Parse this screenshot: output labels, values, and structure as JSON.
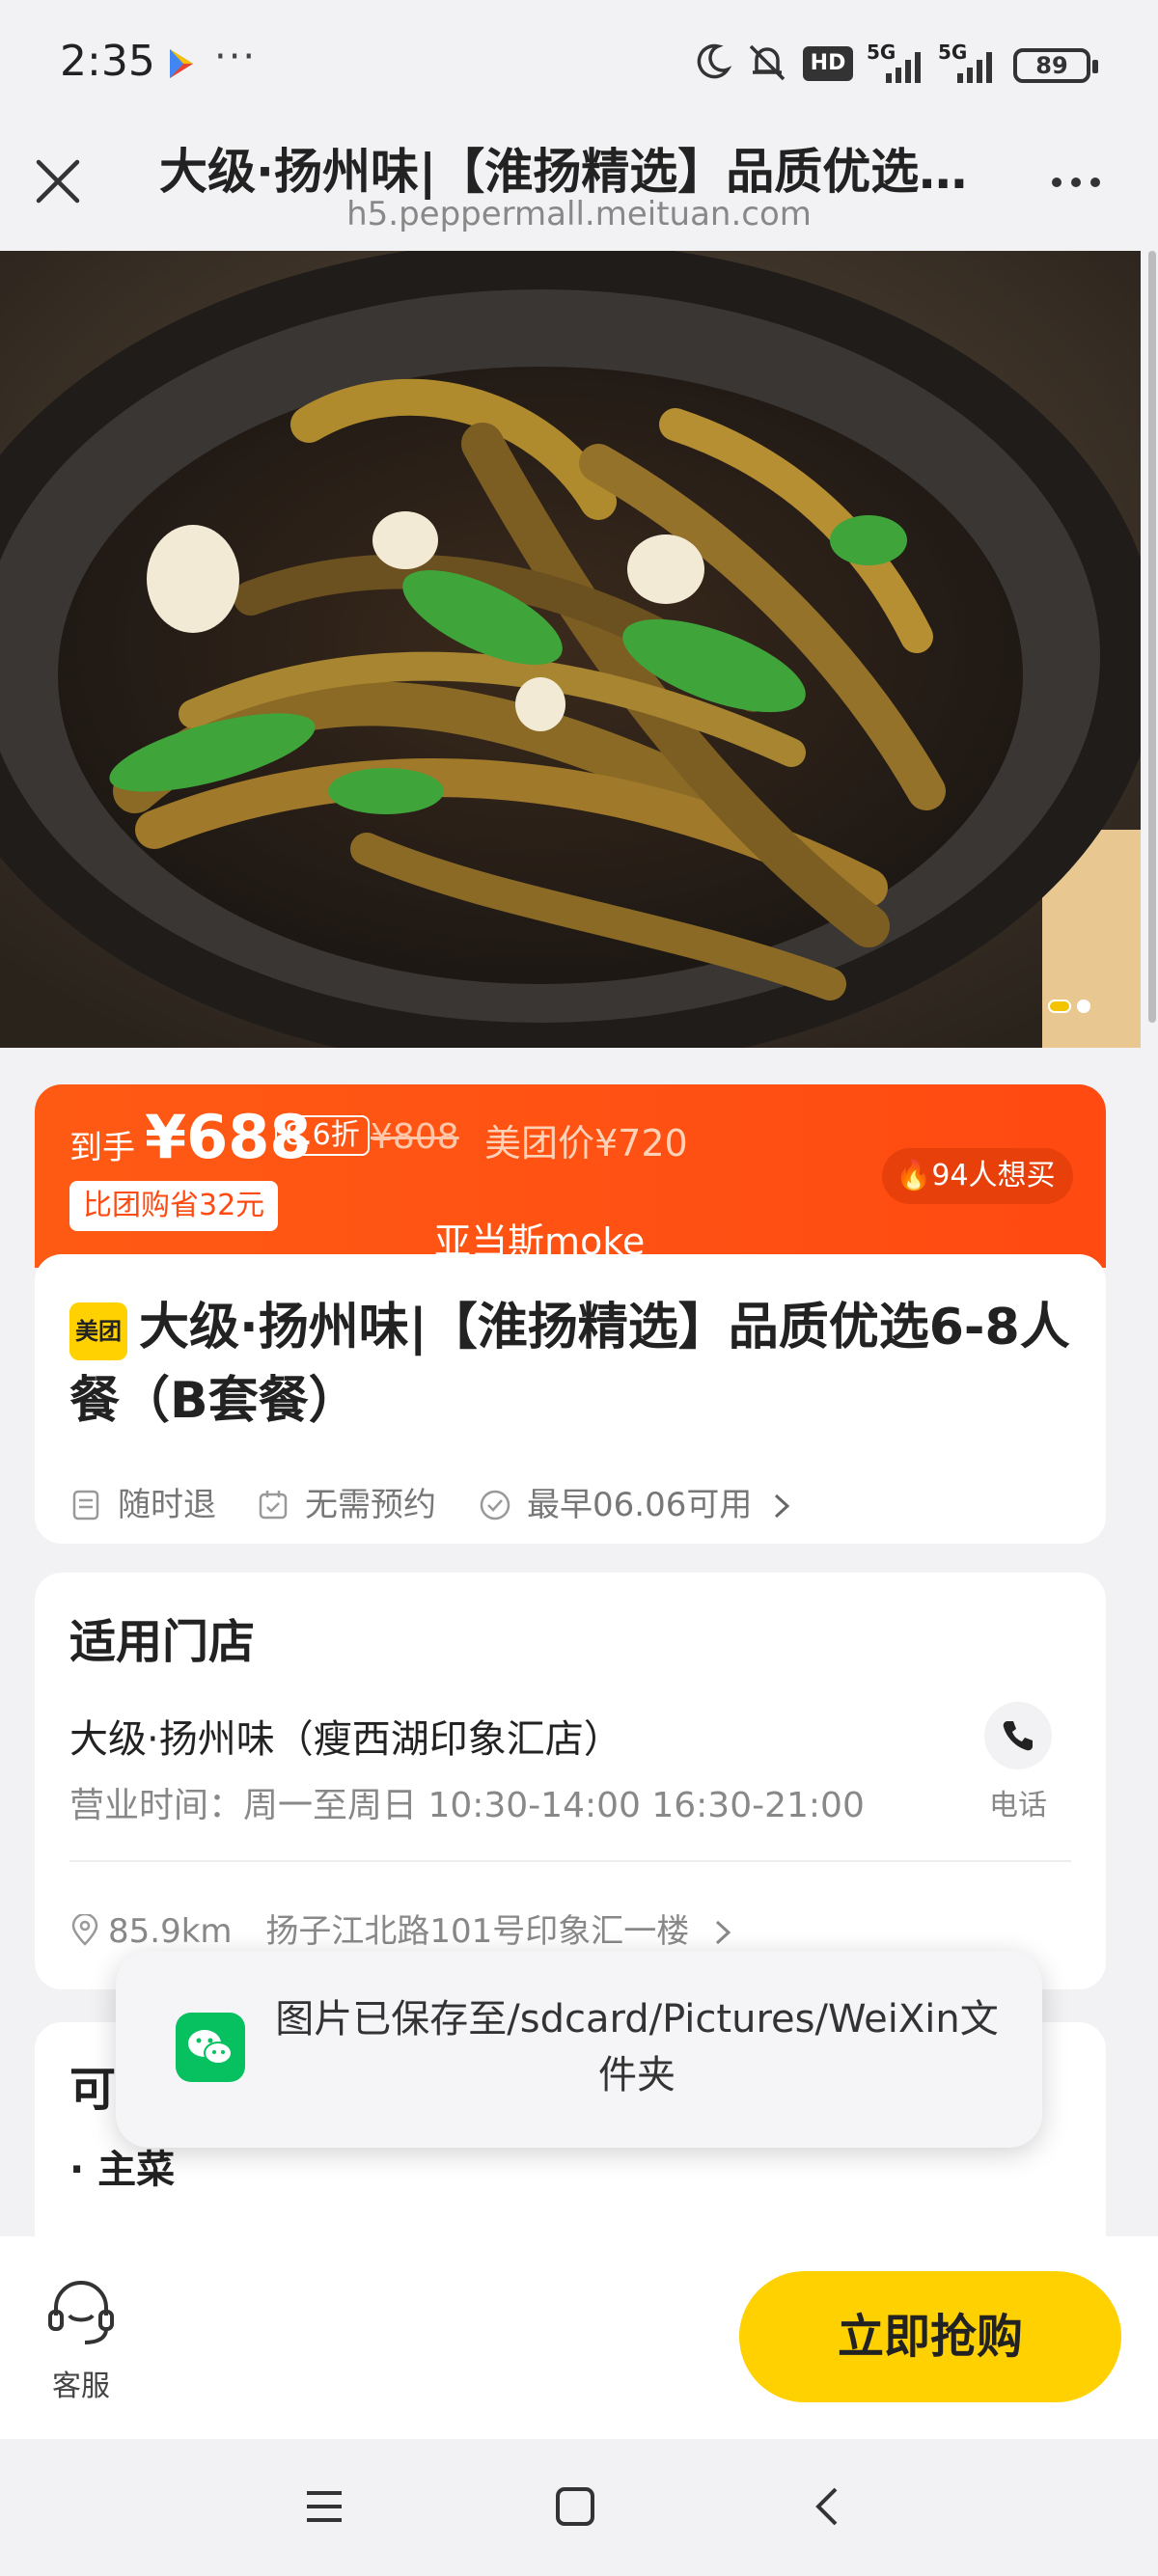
{
  "status_bar": {
    "time": "2:35",
    "more": "···",
    "hd_label": "HD",
    "network_1": "5G",
    "network_2": "5G",
    "battery": "89"
  },
  "title_bar": {
    "title": "大级·扬州味|【淮扬精选】品质优选…",
    "url": "h5.peppermall.meituan.com"
  },
  "price": {
    "prefix": "到手",
    "value": "¥688",
    "discount": "8.6折",
    "original": "¥808",
    "meituan_price": "美团价¥720",
    "save": "比团购省32元",
    "want": "94人想买"
  },
  "watermark": "亚当斯moke",
  "product": {
    "logo_text": "美团",
    "title": "大级·扬州味|【淮扬精选】品质优选6-8人餐（B套餐）",
    "features": [
      "随时退",
      "无需预约",
      "最早06.06可用"
    ]
  },
  "store": {
    "heading": "适用门店",
    "name": "大级·扬州味（瘦西湖印象汇店）",
    "hours": "营业时间：周一至周日 10:30-14:00 16:30-21:00",
    "call_label": "电话",
    "distance": "85.9km",
    "address": "扬子江北路101号印象汇一楼"
  },
  "menu": {
    "heading": "可",
    "category": "· 主菜"
  },
  "toast": {
    "text": "图片已保存至/sdcard/Pictures/WeiXin文件夹"
  },
  "bottom": {
    "service_label": "客服",
    "buy_label": "立即抢购"
  },
  "colors": {
    "accent": "#ff4a12",
    "buy": "#ffd100"
  }
}
